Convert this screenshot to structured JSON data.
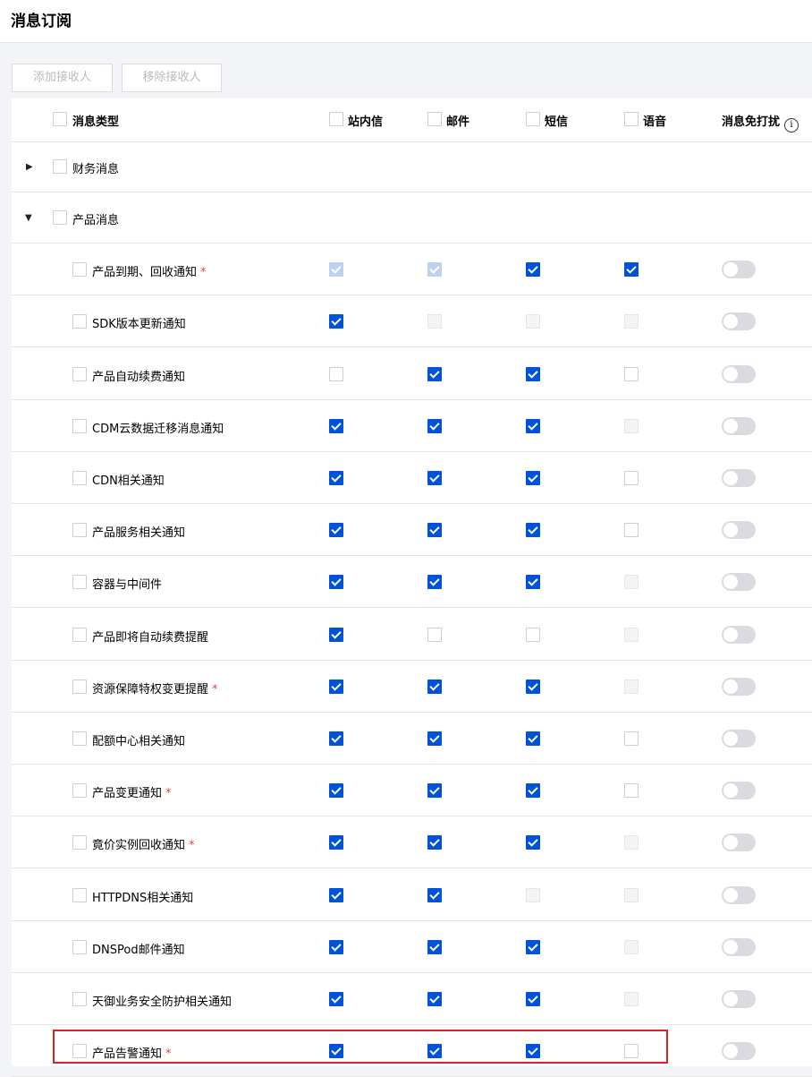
{
  "page": {
    "title": "消息订阅"
  },
  "toolbar": {
    "add_label": "添加接收人",
    "remove_label": "移除接收人"
  },
  "header": {
    "type": "消息类型",
    "site": "站内信",
    "mail": "邮件",
    "sms": "短信",
    "voice": "语音",
    "dnd": "消息免打扰",
    "info_icon": "i"
  },
  "groups": [
    {
      "label": "财务消息",
      "expanded": false
    },
    {
      "label": "产品消息",
      "expanded": true
    }
  ],
  "items": [
    {
      "label": "产品到期、回收通知",
      "required": true,
      "site": "on-disabled",
      "mail": "on-disabled",
      "sms": "on",
      "voice": "on"
    },
    {
      "label": "SDK版本更新通知",
      "required": false,
      "site": "on",
      "mail": "disabled",
      "sms": "disabled",
      "voice": "disabled"
    },
    {
      "label": "产品自动续费通知",
      "required": false,
      "site": "off",
      "mail": "on",
      "sms": "on",
      "voice": "off"
    },
    {
      "label": "CDM云数据迁移消息通知",
      "required": false,
      "site": "on",
      "mail": "on",
      "sms": "on",
      "voice": "disabled"
    },
    {
      "label": "CDN相关通知",
      "required": false,
      "site": "on",
      "mail": "on",
      "sms": "on",
      "voice": "off"
    },
    {
      "label": "产品服务相关通知",
      "required": false,
      "site": "on",
      "mail": "on",
      "sms": "on",
      "voice": "off"
    },
    {
      "label": "容器与中间件",
      "required": false,
      "site": "on",
      "mail": "on",
      "sms": "on",
      "voice": "disabled"
    },
    {
      "label": "产品即将自动续费提醒",
      "required": false,
      "site": "on",
      "mail": "off",
      "sms": "off",
      "voice": "disabled"
    },
    {
      "label": "资源保障特权变更提醒",
      "required": true,
      "site": "on",
      "mail": "on",
      "sms": "on",
      "voice": "disabled"
    },
    {
      "label": "配额中心相关通知",
      "required": false,
      "site": "on",
      "mail": "on",
      "sms": "on",
      "voice": "off"
    },
    {
      "label": "产品变更通知",
      "required": true,
      "site": "on",
      "mail": "on",
      "sms": "on",
      "voice": "off"
    },
    {
      "label": "竟价实例回收通知",
      "required": true,
      "site": "on",
      "mail": "on",
      "sms": "on",
      "voice": "disabled"
    },
    {
      "label": "HTTPDNS相关通知",
      "required": false,
      "site": "on",
      "mail": "on",
      "sms": "disabled",
      "voice": "disabled"
    },
    {
      "label": "DNSPod邮件通知",
      "required": false,
      "site": "on",
      "mail": "on",
      "sms": "on",
      "voice": "disabled"
    },
    {
      "label": "天御业务安全防护相关通知",
      "required": false,
      "site": "on",
      "mail": "on",
      "sms": "on",
      "voice": "disabled"
    },
    {
      "label": "产品告警通知",
      "required": true,
      "site": "on",
      "mail": "on",
      "sms": "on",
      "voice": "off"
    }
  ],
  "required_mark": "*",
  "colors": {
    "accent": "#0052d9",
    "highlight": "#d9232c",
    "required": "#e54545"
  }
}
